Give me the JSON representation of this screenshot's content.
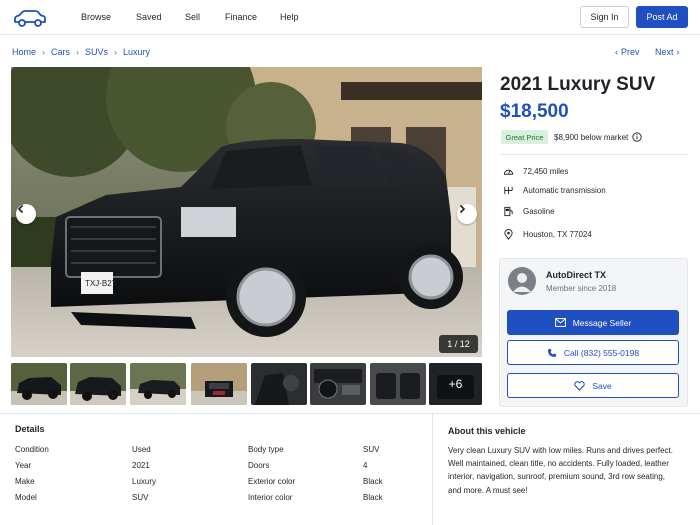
{
  "header": {
    "logo_icon": "car-icon",
    "nav": [
      "Browse",
      "Saved",
      "Sell",
      "Finance",
      "Help"
    ],
    "sign_in": "Sign In",
    "post_ad": "Post Ad"
  },
  "breadcrumb": {
    "items": [
      "Home",
      "Cars",
      "SUVs",
      "Luxury"
    ],
    "prev": "Prev",
    "next": "Next"
  },
  "gallery": {
    "counter": "1 / 12",
    "more_label": "+6"
  },
  "listing": {
    "title": "2021 Luxury SUV",
    "price": "$18,500",
    "badge": "Great Price",
    "below_market": "$8,900 below market",
    "specs": [
      {
        "icon": "speedometer-icon",
        "text": "72,450 miles"
      },
      {
        "icon": "gearbox-icon",
        "text": "Automatic transmission"
      },
      {
        "icon": "fuel-pump-icon",
        "text": "Gasoline"
      },
      {
        "icon": "location-pin-icon",
        "text": "Houston, TX 77024"
      }
    ]
  },
  "seller": {
    "name": "AutoDirect TX",
    "since": "Member since 2018",
    "message": "Message Seller",
    "call": "Call (832) 555-0198",
    "save": "Save"
  },
  "details": {
    "heading": "Details",
    "rows": [
      {
        "k1": "Condition",
        "v1": "Used",
        "k2": "Body type",
        "v2": "SUV"
      },
      {
        "k1": "Year",
        "v1": "2021",
        "k2": "Doors",
        "v2": "4"
      },
      {
        "k1": "Make",
        "v1": "Luxury",
        "k2": "Exterior color",
        "v2": "Black"
      },
      {
        "k1": "Model",
        "v1": "SUV",
        "k2": "Interior color",
        "v2": "Black"
      }
    ]
  },
  "about": {
    "heading": "About this vehicle",
    "text": "Very clean Luxury SUV with low miles. Runs and drives perfect. Well maintained, clean title, no accidents. Fully loaded, leather interior, navigation, sunroof, premium sound, 3rd row seating, and more. A must see!"
  },
  "colors": {
    "accent": "#1f4fc1",
    "badge_bg": "#d9f0df",
    "badge_text": "#1e6e38"
  }
}
